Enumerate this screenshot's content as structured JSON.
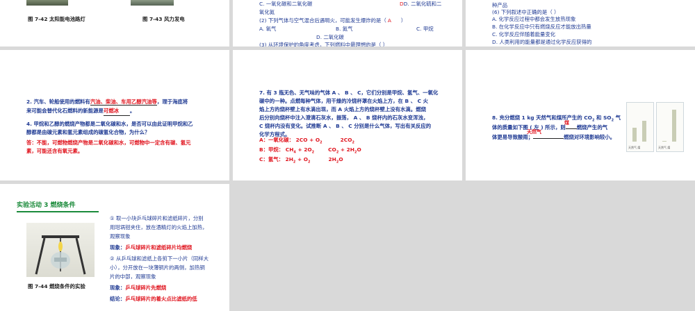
{
  "slide1": {
    "caption_a": "图 7-42  太阳能电池路灯",
    "caption_b": "图 7-43  风力发电"
  },
  "slide2": {
    "line1_left": "C. 一氧化碳和二氧化碳",
    "line1_right": "D. 二氧化硫和二",
    "line2": "氧化氮",
    "line3": "(2) 下列气体与空气混合后遇明火，可能发生爆炸的是（",
    "line3_mark": "A",
    "line3_end": "）",
    "opt_a": "A. 氧气",
    "opt_b": "B. 氮气",
    "opt_c": "C. 甲烷",
    "opt_d": "D. 二氧化碳",
    "line5": "(3) 从环境保护的角度考虑，下列燃料中最理想的是（        ）"
  },
  "slide3": {
    "line0": "种产品",
    "line1": "(6) 下列叙述中正确的是（        ）",
    "opt_a": "A. 化学反应过程中都会发生放热现象",
    "opt_b": "B. 在化学反应中只有燃烧反应才能放出热量",
    "opt_c": "C. 化学反应伴随着能量变化",
    "opt_d": "D. 人类利用的能量都是通过化学反应获得的"
  },
  "slide4": {
    "q2_pre": "2. 汽车、轮船使用的燃料有",
    "q2_ans1": "汽油、柴油、车用乙醇汽油等",
    "q2_post": "，理于海底将",
    "q2_line2_pre": "来可能会替代化石燃料的新能源是",
    "q2_ans2": "可燃冰",
    "q2_line2_post": "。",
    "q3_line1": "4. 甲烷和乙醇的燃烧产物都是二氧化碳和水，是否可以由此证明甲烷和乙",
    "q3_line2": "醇都是由碳元素和氢元素组成的碳氢化合物，为什么？",
    "ans_line1": "答：不能，可燃物燃烧产物是二氧化碳和水，可燃物中一定含有碳、氢元",
    "ans_line2": "素，可能还含有氧元素。"
  },
  "slide5": {
    "lines": [
      "7. 有 3 瓶无色、无气味的气体 A 、 B 、 C，它们分别是甲烷、氢气、一氧化",
      "碳中的一种。点燃每种气体，用干燥的冷烧杯罩在火焰上方，在 B 、 C 火",
      "焰上方的烧杯壁上有水滴出现，而 A 火焰上方的烧杯壁上没有水滴。燃烧",
      "后分别向烧杯中注入澄清石灰水，振荡， A 、 B 烧杯内的石灰水变浑浊，",
      "C 烧杯内没有变化。试推断 A 、 B 、 C 分别是什么气体，写出有关反应的",
      "化学方程式。"
    ],
    "eq_a_label": "A：一氧化碳：",
    "eq_a_lhs": "2CO + O",
    "eq_a_rhs": "2CO",
    "eq_b_label": "B：甲烷：",
    "eq_b_lhs": "CH",
    "eq_b_mid": " + 2O",
    "eq_b_rhs": "CO",
    "eq_b_rhs2": " + 2H",
    "eq_b_rhs3": "O",
    "eq_c_label": "C：氢气：",
    "eq_c_lhs": "2H",
    "eq_c_mid": " + O",
    "eq_c_rhs": "2H",
    "eq_c_rhs2": "O",
    "sub2": "2",
    "sub4": "4"
  },
  "slide6": {
    "line1": "8. 充分燃烧 1 kg 天然气和煤所产生的 CO",
    "line1_b": " 和 SO",
    "line1_c": " 气",
    "line2_pre": "体的质量如下图 ( 左 ) 所示，则",
    "line2_post": "燃烧产生的气",
    "line3_pre": "体更易导致酸雨；",
    "line3_post": "燃烧对环境影响较小。",
    "ans1": "煤",
    "ans2": "天然气",
    "sub2": "2",
    "chart_left_caption": "天然气  煤",
    "chart_right_caption": "天然气  煤"
  },
  "slide7": {
    "title": "实验活动 3  燃烧条件",
    "step1_lines": [
      "① 取一小块乒乓球碎片和滤纸碎片，分别",
      "用坩埚钳夹住，放在酒精灯的火焰上加热，",
      "观察现象"
    ],
    "obs1_label": "现象：",
    "obs1": "乒乓球碎片和滤纸碎片均燃烧",
    "step2_lines": [
      "② 从乒乓球和滤纸上各剪下一小片（同样大",
      "小），分开放在一块薄铜片的两侧，加热铜",
      "片的中部，观察现象"
    ],
    "obs2_label": "现象：",
    "obs2": "乒乓球碎片先燃烧",
    "concl_label": "结论：",
    "concl": "乒乓球碎片的着火点比滤纸的低",
    "caption": "图 7-44  燃烧条件的实验"
  },
  "colors": {
    "answer": "#e0141e",
    "accent_green": "#1a8a3a",
    "text_blue": "#1f3a93",
    "grid_bg": "#d9d9d9"
  }
}
